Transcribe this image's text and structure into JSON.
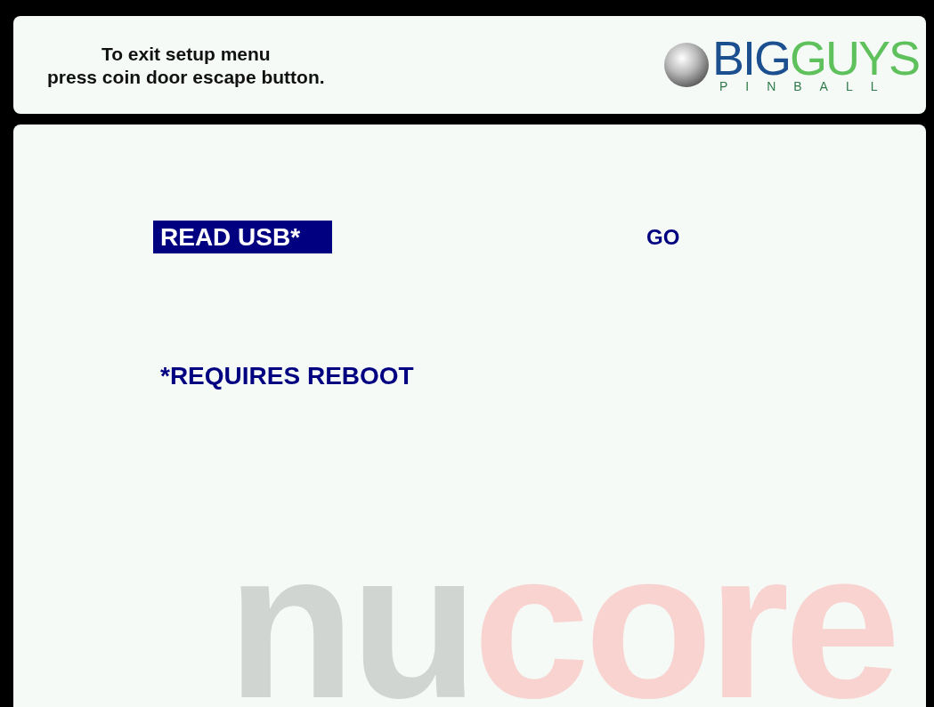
{
  "header": {
    "instructions": [
      "To exit setup menu",
      "press coin door escape button."
    ],
    "logo": {
      "word_1": "BIG",
      "word_2": "GUYS",
      "subtitle": "PINBALL"
    }
  },
  "menu": [
    {
      "label": "READ USB*",
      "value": "GO",
      "selected": true
    }
  ],
  "note": "*REQUIRES REBOOT",
  "background_logo": {
    "part_1": "nu",
    "part_2": "core"
  }
}
